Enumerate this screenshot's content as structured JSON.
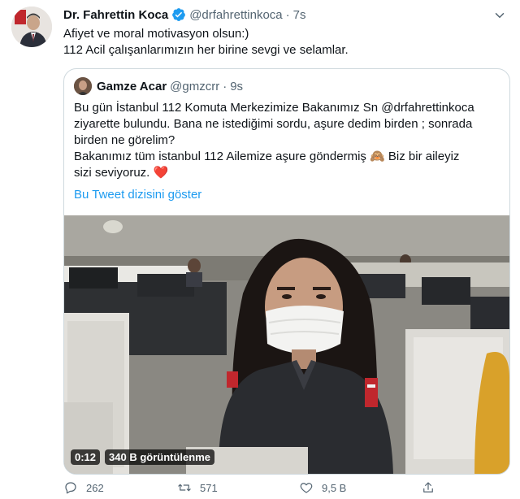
{
  "author": {
    "name": "Dr. Fahrettin Koca",
    "handle": "@drfahrettinkoca",
    "separator": "·",
    "time": "7s",
    "verified_icon": "verified-badge-icon"
  },
  "tweet": {
    "lines": [
      "Afiyet ve moral motivasyon olsun:)",
      "112 Acil çalışanlarımızın her birine sevgi ve selamlar."
    ]
  },
  "quote": {
    "name": "Gamze Acar",
    "handle": "@gmzcrr",
    "separator": "·",
    "time": "9s",
    "lines": [
      "Bu gün İstanbul 112 Komuta Merkezimize Bakanımız Sn @drfahrettinkoca",
      "ziyarette bulundu. Bana ne istediğimi sordu, aşure dedim birden ; sonrada",
      "birden ne görelim?",
      "Bakanımız tüm istanbul 112 Ailemize aşure göndermiş 🙈 Biz bir aileyiz",
      "sizi seviyoruz. ❤️"
    ],
    "show_thread": "Bu Tweet dizisini göster",
    "video": {
      "duration": "0:12",
      "views": "340 B görüntülenme"
    }
  },
  "actions": {
    "reply": "262",
    "retweet": "571",
    "like": "9,5 B"
  },
  "colors": {
    "link": "#1d9bf0",
    "secondary": "#536471",
    "border": "#cfd9de",
    "text": "#0f1419"
  }
}
